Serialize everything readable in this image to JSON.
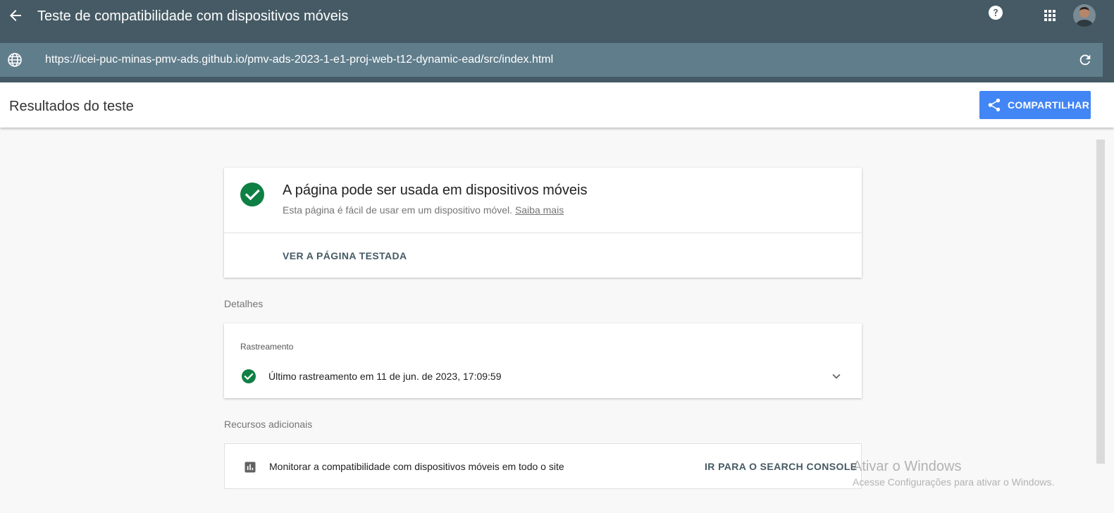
{
  "colors": {
    "header_bg": "#455a64",
    "urlbar_bg": "#607d8b",
    "accent_blue": "#4285f4",
    "success_green": "#0f8043"
  },
  "header": {
    "title": "Teste de compatibilidade com dispositivos móveis",
    "back_icon": "arrow-back-icon",
    "help_icon": "help-icon",
    "apps_icon": "apps-grid-icon",
    "avatar_icon": "user-avatar"
  },
  "urlbar": {
    "icon": "globe-icon",
    "url": "https://icei-puc-minas-pmv-ads.github.io/pmv-ads-2023-1-e1-proj-web-t12-dynamic-ead/src/index.html",
    "refresh_icon": "refresh-icon"
  },
  "results": {
    "title": "Resultados do teste",
    "share_label": "COMPARTILHAR",
    "share_icon": "share-icon"
  },
  "verdict": {
    "icon": "check-circle-icon",
    "title": "A página pode ser usada em dispositivos móveis",
    "subtitle": "Esta página é fácil de usar em um dispositivo móvel.",
    "learn_more": "Saiba mais",
    "view_page": "VER A PÁGINA TESTADA"
  },
  "details": {
    "section_label": "Detalhes",
    "crawl_label": "Rastreamento",
    "crawl_text": "Último rastreamento em 11 de jun. de 2023, 17:09:59",
    "expand_icon": "chevron-down-icon"
  },
  "resources": {
    "section_label": "Recursos adicionais",
    "icon": "bar-chart-icon",
    "text": "Monitorar a compatibilidade com dispositivos móveis em todo o site",
    "action": "IR PARA O SEARCH CONSOLE"
  },
  "watermark": {
    "title": "Ativar o Windows",
    "subtitle": "Acesse Configurações para ativar o Windows."
  }
}
